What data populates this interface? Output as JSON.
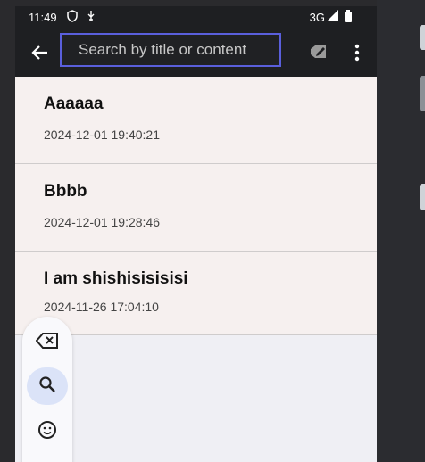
{
  "status_bar": {
    "time": "11:49",
    "network": "3G",
    "icons": [
      "shield-icon",
      "signal-icon",
      "battery-icon"
    ]
  },
  "app_bar": {
    "back_icon": "arrow-left-icon",
    "search_placeholder": "Search by title or content",
    "search_value": "",
    "actions": [
      "tag-icon",
      "more-vert-icon"
    ]
  },
  "notes": [
    {
      "title": "Aaaaaa",
      "date": "2024-12-01 19:40:21"
    },
    {
      "title": "Bbbb",
      "date": "2024-12-01 19:28:46"
    },
    {
      "title": "I am shishisisisisi",
      "date": "2024-11-26 17:04:10"
    }
  ],
  "toolbar": {
    "buttons": [
      {
        "icon": "backspace-icon",
        "active": false
      },
      {
        "icon": "search-icon",
        "active": true
      },
      {
        "icon": "emoji-icon",
        "active": false
      }
    ]
  },
  "colors": {
    "bar": "#1e1f22",
    "search_border": "#5a5fdc",
    "note_bg": "#f6f0ef",
    "active_button": "#dbe3f8"
  }
}
